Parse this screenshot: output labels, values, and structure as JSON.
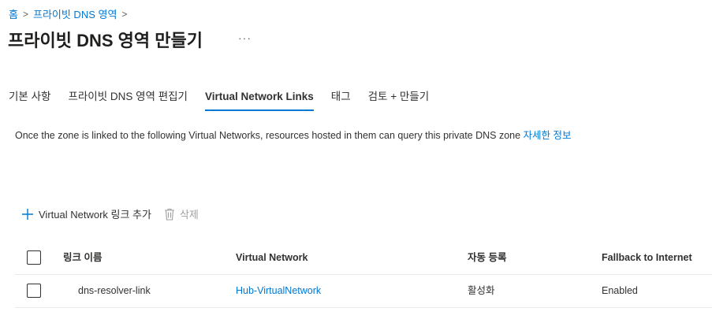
{
  "breadcrumb": {
    "home": "홈",
    "current": "프라이빗 DNS 영역"
  },
  "page": {
    "title": "프라이빗 DNS 영역 만들기",
    "more": "···"
  },
  "tabs": [
    {
      "label": "기본 사항"
    },
    {
      "label": "프라이빗 DNS 영역 편집기"
    },
    {
      "label": "Virtual Network Links",
      "active": true
    },
    {
      "label": "태그"
    },
    {
      "label": "검토 + 만들기"
    }
  ],
  "description": {
    "text": "Once the zone is linked to the following Virtual Networks, resources hosted in them can query this private DNS zone ",
    "link": "자세한 정보"
  },
  "toolbar": {
    "add_label": "Virtual Network 링크 추가",
    "add_icon": "plus-icon",
    "delete_label": "삭제",
    "delete_icon": "trash-icon"
  },
  "table": {
    "columns": [
      "링크 이름",
      "Virtual Network",
      "자동 등록",
      "Fallback to Internet"
    ],
    "rows": [
      {
        "link_name": "dns-resolver-link",
        "virtual_network": "Hub-VirtualNetwork",
        "auto_registration": "활성화",
        "fallback": "Enabled"
      }
    ]
  },
  "colors": {
    "accent": "#0078d4",
    "text": "#323130",
    "disabled": "#a19f9d"
  }
}
